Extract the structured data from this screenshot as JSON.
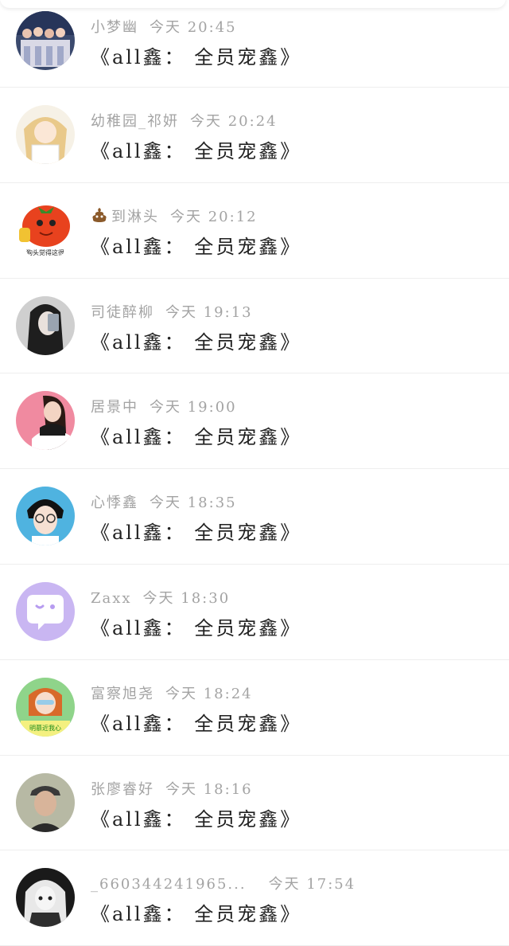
{
  "comments": [
    {
      "user": "小梦幽",
      "time": "今天 20:45",
      "text": "《all鑫： 全员宠鑫》",
      "avatar": "group-photo"
    },
    {
      "user": "幼稚园_祁妍",
      "time": "今天 20:24",
      "text": "《all鑫： 全员宠鑫》",
      "avatar": "anime-girl"
    },
    {
      "user": "到淋头",
      "time": "今天 20:12",
      "text": "《all鑫： 全员宠鑫》",
      "avatar": "tomato-thumbs-up",
      "emoji": "poop-emoji",
      "avatar_caption": "狗头觉得这很"
    },
    {
      "user": "司徒醉柳",
      "time": "今天 19:13",
      "text": "《all鑫： 全员宠鑫》",
      "avatar": "girl-phone"
    },
    {
      "user": "居景中",
      "time": "今天 19:00",
      "text": "《all鑫： 全员宠鑫》",
      "avatar": "woman-pink"
    },
    {
      "user": "心悸鑫",
      "time": "今天 18:35",
      "text": "《all鑫： 全员宠鑫》",
      "avatar": "boy-glasses"
    },
    {
      "user": "Zaxx",
      "time": "今天 18:30",
      "text": "《all鑫： 全员宠鑫》",
      "avatar": "chat-bubble-default"
    },
    {
      "user": "富察旭尧",
      "time": "今天 18:24",
      "text": "《all鑫： 全员宠鑫》",
      "avatar": "girl-green",
      "avatar_caption": "明慕近我心"
    },
    {
      "user": "张廖睿好",
      "time": "今天 18:16",
      "text": "《all鑫： 全员宠鑫》",
      "avatar": "man-cap"
    },
    {
      "user": "_6603442419​65...",
      "time": "今天 17:54",
      "text": "《all鑫： 全员宠鑫》",
      "avatar": "anime-bw"
    }
  ]
}
